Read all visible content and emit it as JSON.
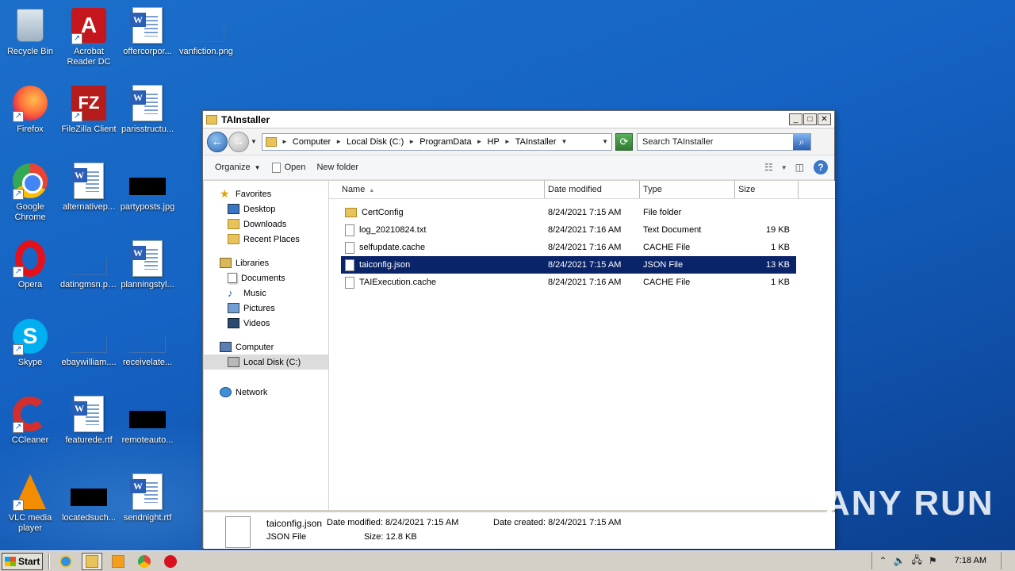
{
  "desktop": {
    "icons": [
      {
        "label": "Recycle Bin",
        "icon": "recycle-bin-icon"
      },
      {
        "label": "Acrobat Reader DC",
        "icon": "acrobat-icon"
      },
      {
        "label": "offercorpor...",
        "icon": "word-doc-icon"
      },
      {
        "label": "vanfiction.png",
        "icon": "image-file-icon"
      },
      {
        "label": "Firefox",
        "icon": "firefox-icon"
      },
      {
        "label": "FileZilla Client",
        "icon": "filezilla-icon"
      },
      {
        "label": "parisstructu...",
        "icon": "word-doc-icon"
      },
      {
        "label": "Google Chrome",
        "icon": "chrome-icon"
      },
      {
        "label": "alternativep...",
        "icon": "word-doc-icon"
      },
      {
        "label": "partyposts.jpg",
        "icon": "image-file-icon"
      },
      {
        "label": "Opera",
        "icon": "opera-icon"
      },
      {
        "label": "datingmsn.png",
        "icon": "image-file-icon"
      },
      {
        "label": "planningstyl...",
        "icon": "word-doc-icon"
      },
      {
        "label": "Skype",
        "icon": "skype-icon"
      },
      {
        "label": "ebaywilliam....",
        "icon": "image-file-icon"
      },
      {
        "label": "receivelate...",
        "icon": "image-file-icon"
      },
      {
        "label": "CCleaner",
        "icon": "ccleaner-icon"
      },
      {
        "label": "featurede.rtf",
        "icon": "word-doc-icon"
      },
      {
        "label": "remoteauto...",
        "icon": "image-file-icon"
      },
      {
        "label": "VLC media player",
        "icon": "vlc-icon"
      },
      {
        "label": "locatedsuch...",
        "icon": "image-file-icon"
      },
      {
        "label": "sendnight.rtf",
        "icon": "word-doc-icon"
      }
    ]
  },
  "window": {
    "title": "TAInstaller",
    "breadcrumb": [
      "Computer",
      "Local Disk (C:)",
      "ProgramData",
      "HP",
      "TAInstaller"
    ],
    "search_placeholder": "Search TAInstaller",
    "toolbar": {
      "organize": "Organize",
      "open": "Open",
      "new_folder": "New folder"
    },
    "nav": {
      "favorites": "Favorites",
      "desktop": "Desktop",
      "downloads": "Downloads",
      "recent": "Recent Places",
      "libraries": "Libraries",
      "documents": "Documents",
      "music": "Music",
      "pictures": "Pictures",
      "videos": "Videos",
      "computer": "Computer",
      "local_disk": "Local Disk (C:)",
      "network": "Network"
    },
    "columns": {
      "name": "Name",
      "date": "Date modified",
      "type": "Type",
      "size": "Size"
    },
    "files": [
      {
        "name": "CertConfig",
        "date": "8/24/2021 7:15 AM",
        "type": "File folder",
        "size": ""
      },
      {
        "name": "log_20210824.txt",
        "date": "8/24/2021 7:16 AM",
        "type": "Text Document",
        "size": "19 KB"
      },
      {
        "name": "selfupdate.cache",
        "date": "8/24/2021 7:16 AM",
        "type": "CACHE File",
        "size": "1 KB"
      },
      {
        "name": "taiconfig.json",
        "date": "8/24/2021 7:15 AM",
        "type": "JSON File",
        "size": "13 KB"
      },
      {
        "name": "TAIExecution.cache",
        "date": "8/24/2021 7:16 AM",
        "type": "CACHE File",
        "size": "1 KB"
      }
    ],
    "details": {
      "name": "taiconfig.json",
      "type": "JSON File",
      "date_modified_label": "Date modified:",
      "date_modified": "8/24/2021 7:15 AM",
      "date_created_label": "Date created:",
      "date_created": "8/24/2021 7:15 AM",
      "size_label": "Size:",
      "size": "12.8 KB"
    }
  },
  "watermark": "ANY RUN",
  "taskbar": {
    "start": "Start",
    "clock": "7:18 AM"
  }
}
